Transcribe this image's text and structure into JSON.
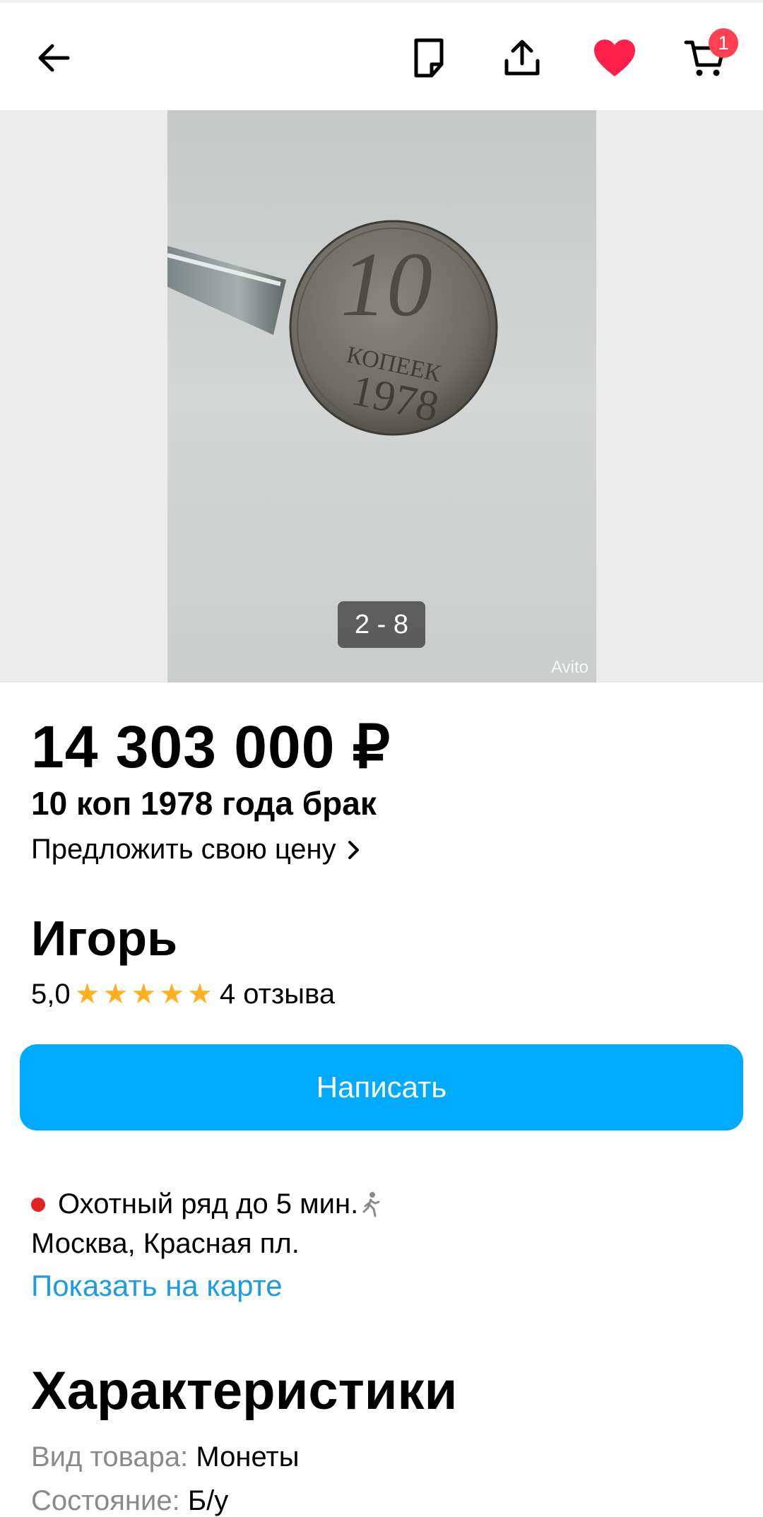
{
  "header": {
    "cart_count": "1"
  },
  "gallery": {
    "counter": "2 - 8",
    "watermark": "Avito",
    "coin_value": "10",
    "coin_word": "КОПЕЕК",
    "coin_year": "1978"
  },
  "listing": {
    "price": "14 303 000 ₽",
    "title": "10 коп 1978 года брак",
    "offer_link": "Предложить свою цену"
  },
  "seller": {
    "name": "Игорь",
    "rating": "5,0",
    "stars": "★★★★★",
    "reviews": "4 отзыва",
    "write_button": "Написать"
  },
  "location": {
    "metro": "Охотный ряд до 5 мин.",
    "address": "Москва, Красная пл.",
    "map_link": "Показать на карте"
  },
  "characteristics": {
    "title": "Характеристики",
    "rows": [
      {
        "key": "Вид товара:",
        "value": "Монеты"
      },
      {
        "key": "Состояние:",
        "value": "Б/у"
      }
    ]
  }
}
